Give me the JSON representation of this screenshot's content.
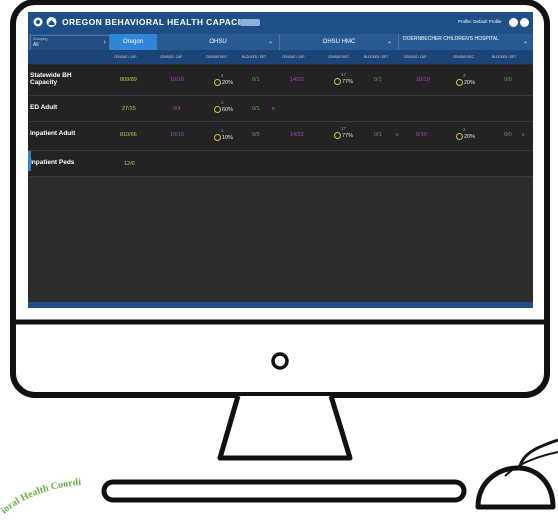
{
  "app": {
    "title": "OREGON BEHAVIORAL HEALTH CAPACITY",
    "title_badge": "",
    "profile_label": "Profile: Default Profile",
    "group_select": {
      "label": "Grouping",
      "value": "All"
    },
    "locations": [
      "Oregon",
      "OHSU",
      "OHSU HMC",
      "DOERNBECHER CHILDREN'S HOSPITAL"
    ],
    "column_headers": {
      "oregon": "CENSUS / CAP",
      "col_a": "CENSUS / CAP",
      "col_b": "CENSUS REC",
      "col_c": "BLOCKED / SET"
    },
    "rows": [
      {
        "label": "Statewide BH Capacity",
        "oregon": "809/89",
        "ohsu": {
          "census": "10/10",
          "gauge_n": "4",
          "gauge_pct": "20%",
          "blocked": "0/1"
        },
        "hmc": {
          "census": "14/22",
          "gauge_n": "17",
          "gauge_pct": "77%",
          "blocked": "0/1"
        },
        "doern": {
          "census": "10/10",
          "gauge_n": "2",
          "gauge_pct": "20%",
          "blocked": "0/0"
        }
      },
      {
        "label": "ED Adult",
        "oregon": "27/25",
        "ohsu": {
          "census": "0/4",
          "gauge_n": "3",
          "gauge_pct": "60%",
          "blocked": "0/1"
        },
        "x": "x"
      },
      {
        "label": "Inpatient Adult",
        "oregon": "810/66",
        "ohsu": {
          "census": "10/10",
          "gauge_n": "1",
          "gauge_pct": "10%",
          "blocked": "0/0"
        },
        "hmc": {
          "census": "14/22",
          "gauge_n": "17",
          "gauge_pct": "77%",
          "blocked": "0/1"
        },
        "doern": {
          "census": "0/10",
          "gauge_n": "2",
          "gauge_pct": "20%",
          "blocked": "0/0"
        },
        "x": "x"
      },
      {
        "label": "Inpatient Peds",
        "oregon": "12/0"
      }
    ]
  },
  "watermark": {
    "text": "ioral Health Coordi"
  },
  "colors": {
    "brand_blue": "#1f4f87",
    "census_yellow": "#b7cf44",
    "census_purple": "#a24ac8",
    "gauge_ring": "#d0c050"
  },
  "icons": [
    "home-icon",
    "profile-icon",
    "help-icon",
    "settings-icon",
    "chevron-right-icon",
    "chevron-down-icon"
  ]
}
